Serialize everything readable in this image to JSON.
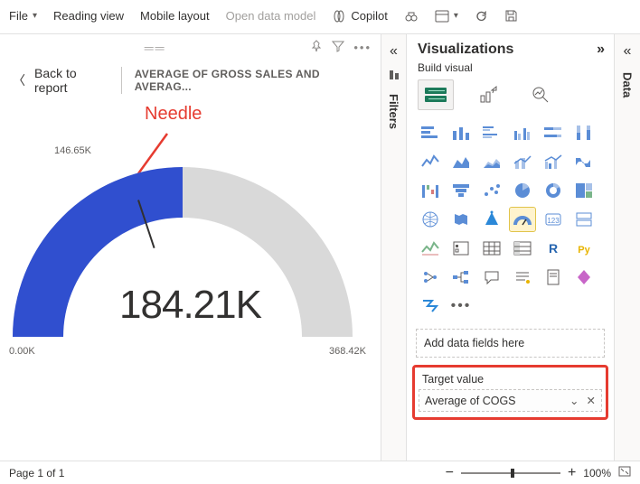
{
  "ribbon": {
    "file": "File",
    "reading_view": "Reading view",
    "mobile_layout": "Mobile layout",
    "open_data_model": "Open data model",
    "copilot": "Copilot"
  },
  "canvas": {
    "back_label": "Back to report",
    "chart_title": "AVERAGE OF GROSS SALES AND AVERAG...",
    "annotation": "Needle"
  },
  "filters": {
    "label": "Filters"
  },
  "viz": {
    "title": "Visualizations",
    "subtitle": "Build visual",
    "field_placeholder": "Add data fields here",
    "target_label": "Target value",
    "target_pill": "Average of COGS"
  },
  "data_pane": {
    "label": "Data"
  },
  "footer": {
    "page": "Page 1 of 1",
    "zoom_pct": "100%"
  },
  "chart_data": {
    "type": "gauge",
    "value": 184.21,
    "value_display": "184.21K",
    "min": 0.0,
    "min_display": "0.00K",
    "max": 368.42,
    "max_display": "368.42K",
    "target": 146.65,
    "target_display": "146.65K",
    "unit": "K",
    "title": "AVERAGE OF GROSS SALES AND AVERAGE OF COGS",
    "fill_color": "#304FCF",
    "empty_color": "#d9d9d9"
  }
}
